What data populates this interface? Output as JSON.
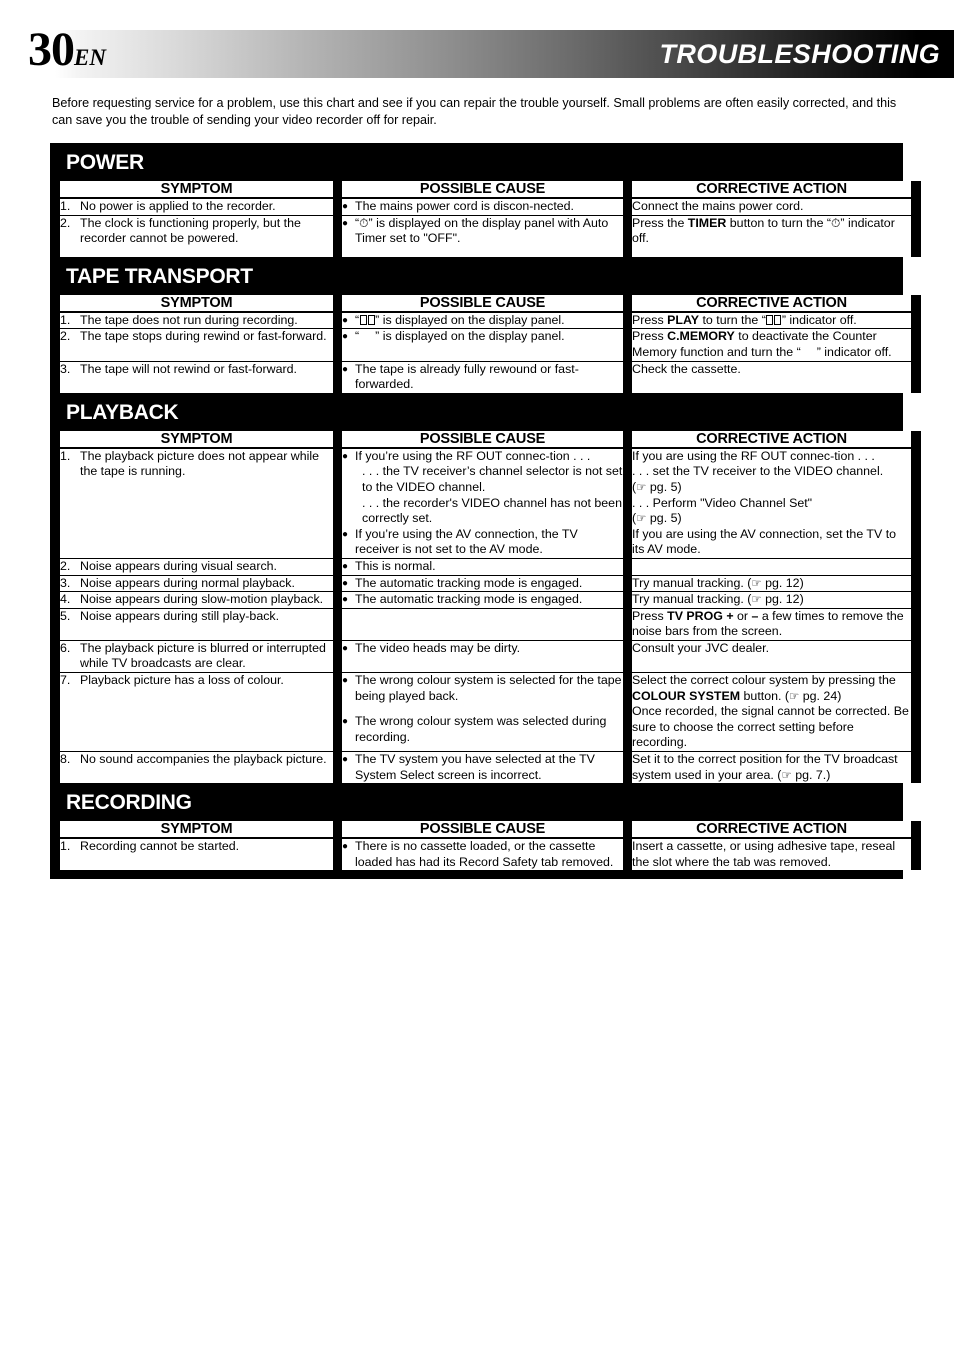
{
  "header": {
    "page_number": "30",
    "language_code": "EN",
    "title": "TROUBLESHOOTING"
  },
  "intro": "Before requesting service for a problem, use this chart and see if you can repair the trouble yourself. Small problems are often easily corrected, and this can save you the trouble of sending your video recorder off for repair.",
  "column_headers": {
    "symptom": "SYMPTOM",
    "possible_cause": "POSSIBLE CAUSE",
    "corrective_action": "CORRECTIVE ACTION"
  },
  "sections": [
    {
      "heading": "POWER",
      "rows": [
        {
          "number": "1.",
          "symptom": "No power is applied to the recorder.",
          "cause_1": "The mains power cord is discon-nected.",
          "action_1": "Connect the mains power cord."
        },
        {
          "number": "2.",
          "symptom": "The clock is functioning properly, but the recorder cannot be powered.",
          "cause_1_a": "“",
          "cause_1_icon": "clock-icon",
          "cause_1_b": "” is displayed on the display panel with Auto Timer set to \"OFF\".",
          "action_1_a": "Press the ",
          "action_1_kw": "TIMER",
          "action_1_b": " button to turn the “",
          "action_1_icon": "clock-icon",
          "action_1_c": "” indicator off."
        }
      ]
    },
    {
      "heading": "TAPE TRANSPORT",
      "rows": [
        {
          "number": "1.",
          "symptom": "The tape does not run during recording.",
          "cause_1_a": "“",
          "cause_1_glyph": "missing-glyph-double",
          "cause_1_b": "” is displayed on the display panel.",
          "action_1_a": "Press ",
          "action_1_kw": "PLAY",
          "action_1_b": " to turn the “",
          "action_1_glyph": "missing-glyph-double",
          "action_1_c": "” indicator off."
        },
        {
          "number": "2.",
          "symptom": "The tape stops during rewind or fast-forward.",
          "cause_1_a": "“",
          "cause_1_glyph": "missing-glyph-blank",
          "cause_1_b": "” is displayed on the display panel.",
          "action_1_a": "Press ",
          "action_1_kw": "C.MEMORY",
          "action_1_b": " to deactivate the Counter Memory function and turn the “",
          "action_1_glyph": "missing-glyph-blank",
          "action_1_c": "” indicator off."
        },
        {
          "number": "3.",
          "symptom": "The tape will not rewind or fast-forward.",
          "cause_1": "The tape is already fully rewound or fast-forwarded.",
          "action_1": "Check the cassette."
        }
      ]
    },
    {
      "heading": "PLAYBACK",
      "rows": [
        {
          "number": "1.",
          "symptom": "The playback picture does not appear while the tape is running.",
          "cause_1": "If you’re using the RF OUT connec-tion . . .",
          "cause_1_sub_a": ". . . the TV receiver’s channel selector is not set to the VIDEO channel.",
          "cause_1_sub_b": ". . . the recorder's VIDEO channel has not been correctly set.",
          "cause_2": "If you’re using the AV connection, the TV receiver is not set to the AV mode.",
          "action_line_1": "If you are using the RF OUT connec-tion . . .",
          "action_line_2": ". . . set the TV receiver to the VIDEO channel. (",
          "action_line_2_ref": "pg. 5)",
          "action_line_3": ". . . Perform \"Video Channel Set\"",
          "action_line_4_ref": "pg. 5)",
          "action_line_5": "If you are using the AV connection, set the TV to its AV mode."
        },
        {
          "number": "2.",
          "symptom": "Noise appears during visual search.",
          "cause_1": "This is normal.",
          "action_1": ""
        },
        {
          "number": "3.",
          "symptom": "Noise appears during normal playback.",
          "cause_1": "The automatic tracking mode is engaged.",
          "action_1_a": "Try manual tracking. (",
          "action_1_ref": "pg. 12)"
        },
        {
          "number": "4.",
          "symptom": "Noise appears during slow-motion playback.",
          "cause_1": "The automatic tracking mode is engaged.",
          "action_1_a": "Try manual tracking. (",
          "action_1_ref": "pg. 12)"
        },
        {
          "number": "5.",
          "symptom": "Noise appears during still play-back.",
          "cause_1": "",
          "action_1_a": "Press ",
          "action_1_kw": "TV PROG +",
          "action_1_b": " or ",
          "action_1_kw2": "–",
          "action_1_c": " a few times to remove the noise bars from the screen."
        },
        {
          "number": "6.",
          "symptom": "The playback picture is blurred or interrupted while TV broadcasts are clear.",
          "cause_1": "The video heads may be dirty.",
          "action_1": "Consult your JVC dealer."
        },
        {
          "number": "7.",
          "symptom": "Playback picture has a loss of colour.",
          "cause_1": "The wrong colour system is selected for the tape being played back.",
          "cause_2": "The wrong colour system was selected during recording.",
          "action_line_1_a": "Select the correct colour system by pressing the ",
          "action_line_1_kw": "COLOUR SYSTEM",
          "action_line_1_b": " button. (",
          "action_line_1_ref": "pg. 24)",
          "action_line_2": "Once recorded, the signal cannot be corrected. Be sure to choose the correct setting before recording."
        },
        {
          "number": "8.",
          "symptom": "No sound accompanies the playback picture.",
          "cause_1": "The TV system you have selected at the TV System Select screen is incorrect.",
          "action_1_a": "Set it to the correct position for the TV broadcast system used in your area. (",
          "action_1_ref": "pg. 7.)"
        }
      ]
    },
    {
      "heading": "RECORDING",
      "rows": [
        {
          "number": "1.",
          "symptom": "Recording cannot be started.",
          "cause_1": "There is no cassette loaded, or the cassette loaded has had its Record Safety tab removed.",
          "action_1": "Insert a cassette, or using adhesive tape, reseal the slot where the tab was removed."
        }
      ]
    }
  ],
  "glyphs": {
    "clock": "⏲",
    "pointing_hand": "☞",
    "bullet": "●"
  },
  "colors": {
    "frame": "#000000",
    "column_header_bg": "#f4f4f4",
    "cell_bg": "#ffffff",
    "text": "#000000",
    "header_title_text": "#ffffff"
  }
}
